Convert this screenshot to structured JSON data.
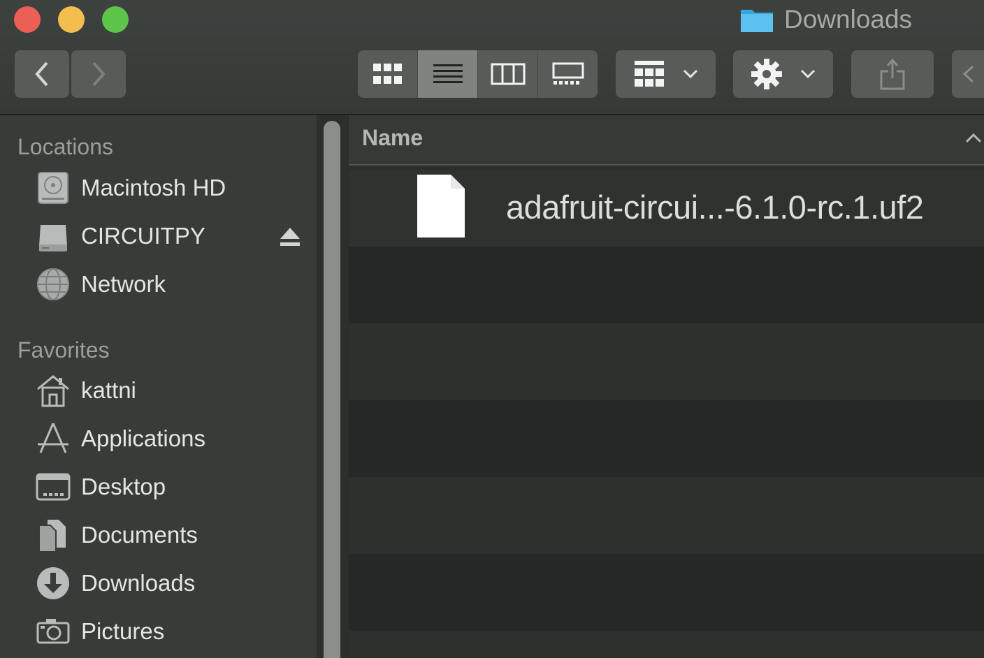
{
  "window": {
    "title": "Downloads",
    "title_icon": "folder-icon"
  },
  "colors": {
    "close": "#ec5f57",
    "minimize": "#f4be4f",
    "maximize": "#5ec54b",
    "folder_accent": "#45b2ec"
  },
  "toolbar": {
    "back_icon": "chevron-left-icon",
    "forward_icon": "chevron-right-icon",
    "view_modes": [
      "icon-view",
      "list-view",
      "column-view",
      "gallery-view"
    ],
    "active_view": "list-view",
    "group_icon": "group-by-icon",
    "action_icon": "gear-icon",
    "share_icon": "share-icon"
  },
  "sidebar": {
    "locations_heading": "Locations",
    "locations": [
      {
        "label": "Macintosh HD",
        "icon": "hard-drive-icon"
      },
      {
        "label": "CIRCUITPY",
        "icon": "external-drive-icon",
        "ejectable": true
      },
      {
        "label": "Network",
        "icon": "network-globe-icon"
      }
    ],
    "favorites_heading": "Favorites",
    "favorites": [
      {
        "label": "kattni",
        "icon": "home-icon"
      },
      {
        "label": "Applications",
        "icon": "applications-icon"
      },
      {
        "label": "Desktop",
        "icon": "desktop-icon"
      },
      {
        "label": "Documents",
        "icon": "documents-icon"
      },
      {
        "label": "Downloads",
        "icon": "downloads-icon"
      },
      {
        "label": "Pictures",
        "icon": "camera-icon"
      }
    ]
  },
  "list": {
    "column_name": "Name",
    "files": [
      {
        "name": "adafruit-circui...-6.1.0-rc.1.uf2",
        "icon": "document-icon"
      }
    ]
  }
}
